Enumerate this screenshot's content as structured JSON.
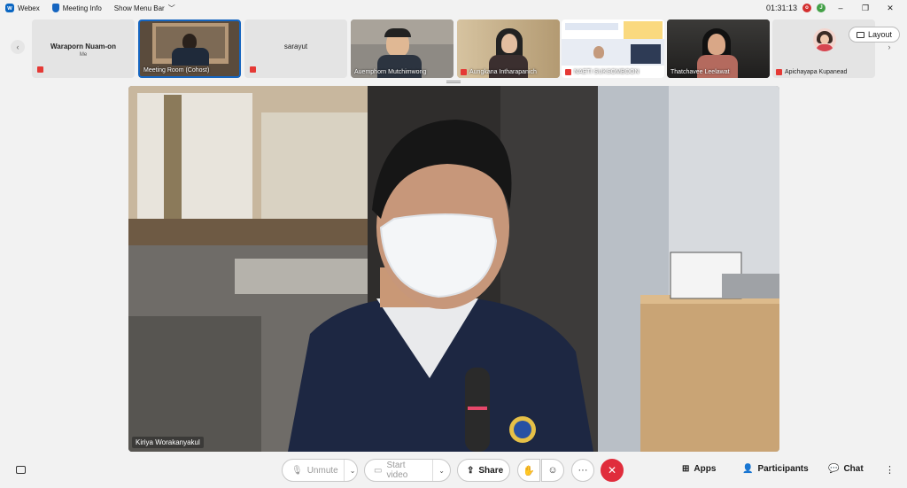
{
  "titlebar": {
    "app_name": "Webex",
    "meeting_info": "Meeting Info",
    "show_menu": "Show Menu Bar",
    "timer": "01:31:13",
    "badge_red": "o",
    "badge_green": "J",
    "minimize": "–",
    "restore": "❐",
    "close": "✕"
  },
  "participants": [
    {
      "name": "Waraporn Nuam-on",
      "sub": "Me",
      "muted": true
    },
    {
      "name": "Meeting Room (Cohost)",
      "muted": false
    },
    {
      "name": "sarayut",
      "muted": true
    },
    {
      "name": "Auemphorn Mutchimwong",
      "muted": false
    },
    {
      "name": "Aungkana Intharapanich",
      "muted": true
    },
    {
      "name": "NAETI SUKSOMBOON",
      "muted": true
    },
    {
      "name": "Thatchavee Leelawat",
      "muted": false
    },
    {
      "name": "Apichayapa Kupanead",
      "muted": true
    }
  ],
  "layout_label": "Layout",
  "main_speaker": "Kiriya Worakanyakul",
  "controls": {
    "unmute": "Unmute",
    "start_video": "Start video",
    "share": "Share",
    "more": "···",
    "end": "✕",
    "apps": "Apps",
    "participants": "Participants",
    "chat": "Chat",
    "overflow": "⋮"
  }
}
